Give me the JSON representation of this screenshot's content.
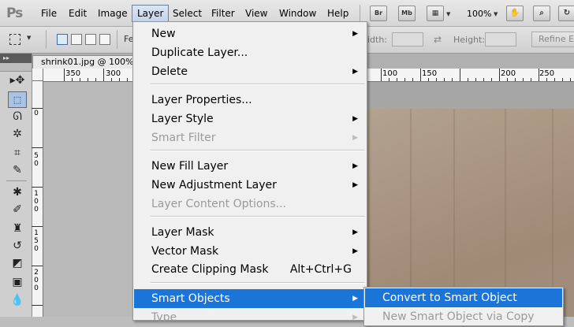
{
  "menubar": {
    "logo": "Ps",
    "items": [
      "File",
      "Edit",
      "Image",
      "Layer",
      "Select",
      "Filter",
      "View",
      "Window",
      "Help"
    ],
    "active_item": "Layer",
    "bridge_label": "Br",
    "minibridge_label": "Mb",
    "zoom": "100%"
  },
  "options": {
    "feather_label": "Fe",
    "width_label": "idth:",
    "height_label": "Height:",
    "refine_label": "Refine Ed"
  },
  "document": {
    "tab_title": "shrink01.jpg @ 100%",
    "ruler_h_left": [
      "350",
      "300"
    ],
    "ruler_h_right": [
      "100",
      "150",
      "200",
      "250"
    ],
    "ruler_v_labels": [
      "0",
      "5 0",
      "1 0 0",
      "1 5 0",
      "2 0 0"
    ]
  },
  "layer_menu": {
    "items": [
      {
        "label": "New",
        "shortcut": "",
        "submenu": true,
        "disabled": false
      },
      {
        "label": "Duplicate Layer...",
        "shortcut": "",
        "submenu": false,
        "disabled": false
      },
      {
        "label": "Delete",
        "shortcut": "",
        "submenu": true,
        "disabled": false
      },
      {
        "label": "Layer Properties...",
        "shortcut": "",
        "submenu": false,
        "disabled": false
      },
      {
        "label": "Layer Style",
        "shortcut": "",
        "submenu": true,
        "disabled": false
      },
      {
        "label": "Smart Filter",
        "shortcut": "",
        "submenu": true,
        "disabled": true
      },
      {
        "label": "New Fill Layer",
        "shortcut": "",
        "submenu": true,
        "disabled": false
      },
      {
        "label": "New Adjustment Layer",
        "shortcut": "",
        "submenu": true,
        "disabled": false
      },
      {
        "label": "Layer Content Options...",
        "shortcut": "",
        "submenu": false,
        "disabled": true
      },
      {
        "label": "Layer Mask",
        "shortcut": "",
        "submenu": true,
        "disabled": false
      },
      {
        "label": "Vector Mask",
        "shortcut": "",
        "submenu": true,
        "disabled": false
      },
      {
        "label": "Create Clipping Mask",
        "shortcut": "Alt+Ctrl+G",
        "submenu": false,
        "disabled": false
      },
      {
        "label": "Smart Objects",
        "shortcut": "",
        "submenu": true,
        "disabled": false,
        "highlighted": true
      },
      {
        "label": "Type",
        "shortcut": "",
        "submenu": true,
        "disabled": true
      }
    ]
  },
  "smart_objects_submenu": {
    "items": [
      {
        "label": "Convert to Smart Object",
        "highlighted": true,
        "disabled": false
      },
      {
        "label": "New Smart Object via Copy",
        "highlighted": false,
        "disabled": true
      }
    ]
  },
  "colors": {
    "highlight": "#1b74d8",
    "menu_bg": "#f0f0f0",
    "disabled_text": "#9a9a9a"
  }
}
